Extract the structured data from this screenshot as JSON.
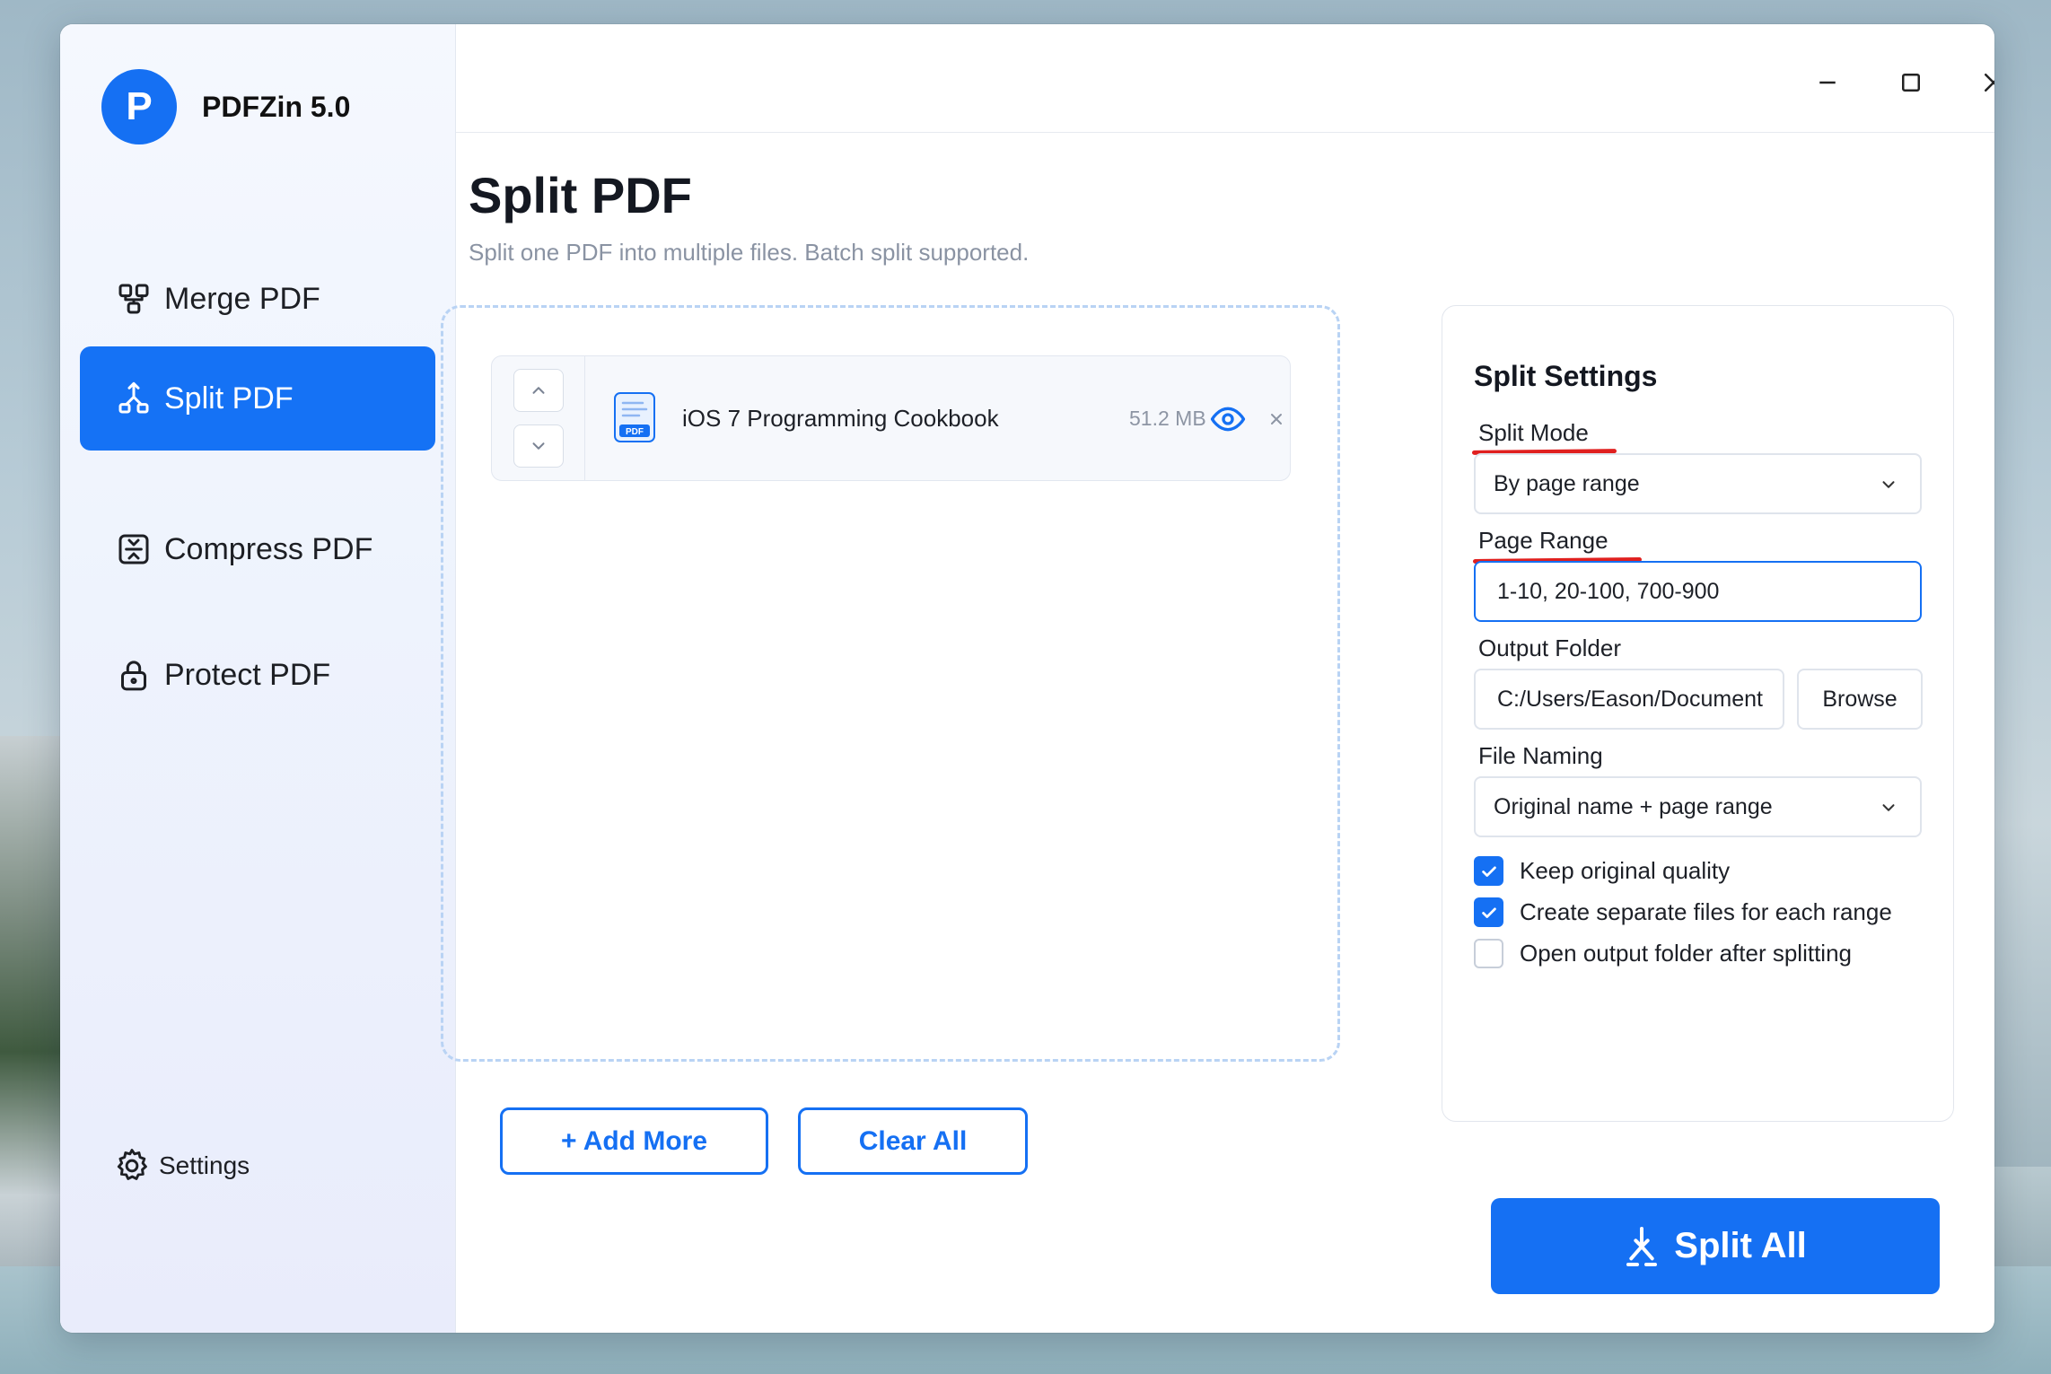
{
  "app": {
    "logo_letter": "P",
    "title": "PDFZin 5.0"
  },
  "sidebar": {
    "items": [
      {
        "label": "Merge PDF",
        "icon": "merge-icon"
      },
      {
        "label": "Split PDF",
        "icon": "split-icon",
        "active": true
      },
      {
        "label": "Compress PDF",
        "icon": "compress-icon"
      },
      {
        "label": "Protect PDF",
        "icon": "lock-icon"
      }
    ],
    "settings_label": "Settings"
  },
  "page": {
    "title": "Split PDF",
    "subtitle": "Split one PDF into multiple files. Batch split supported."
  },
  "files": [
    {
      "name": "iOS 7 Programming Cookbook",
      "size": "51.2 MB",
      "icon_label": "PDF"
    }
  ],
  "actions": {
    "add_more": "+ Add More",
    "clear_all": "Clear All",
    "split_all": "Split All"
  },
  "settings": {
    "title": "Split Settings",
    "split_mode_label": "Split Mode",
    "split_mode_value": "By page range",
    "page_range_label": "Page Range",
    "page_range_value": "1-10, 20-100, 700-900",
    "output_folder_label": "Output Folder",
    "output_folder_value": "C:/Users/Eason/Document",
    "browse_label": "Browse",
    "file_naming_label": "File Naming",
    "file_naming_value": "Original name + page range",
    "checkboxes": [
      {
        "label": "Keep original quality",
        "checked": true
      },
      {
        "label": "Create separate files for each range",
        "checked": true
      },
      {
        "label": "Open output folder after splitting",
        "checked": false
      }
    ]
  },
  "colors": {
    "accent": "#1570f3",
    "annotation": "#e0201f",
    "dropzone_border": "#b9d3f4"
  }
}
